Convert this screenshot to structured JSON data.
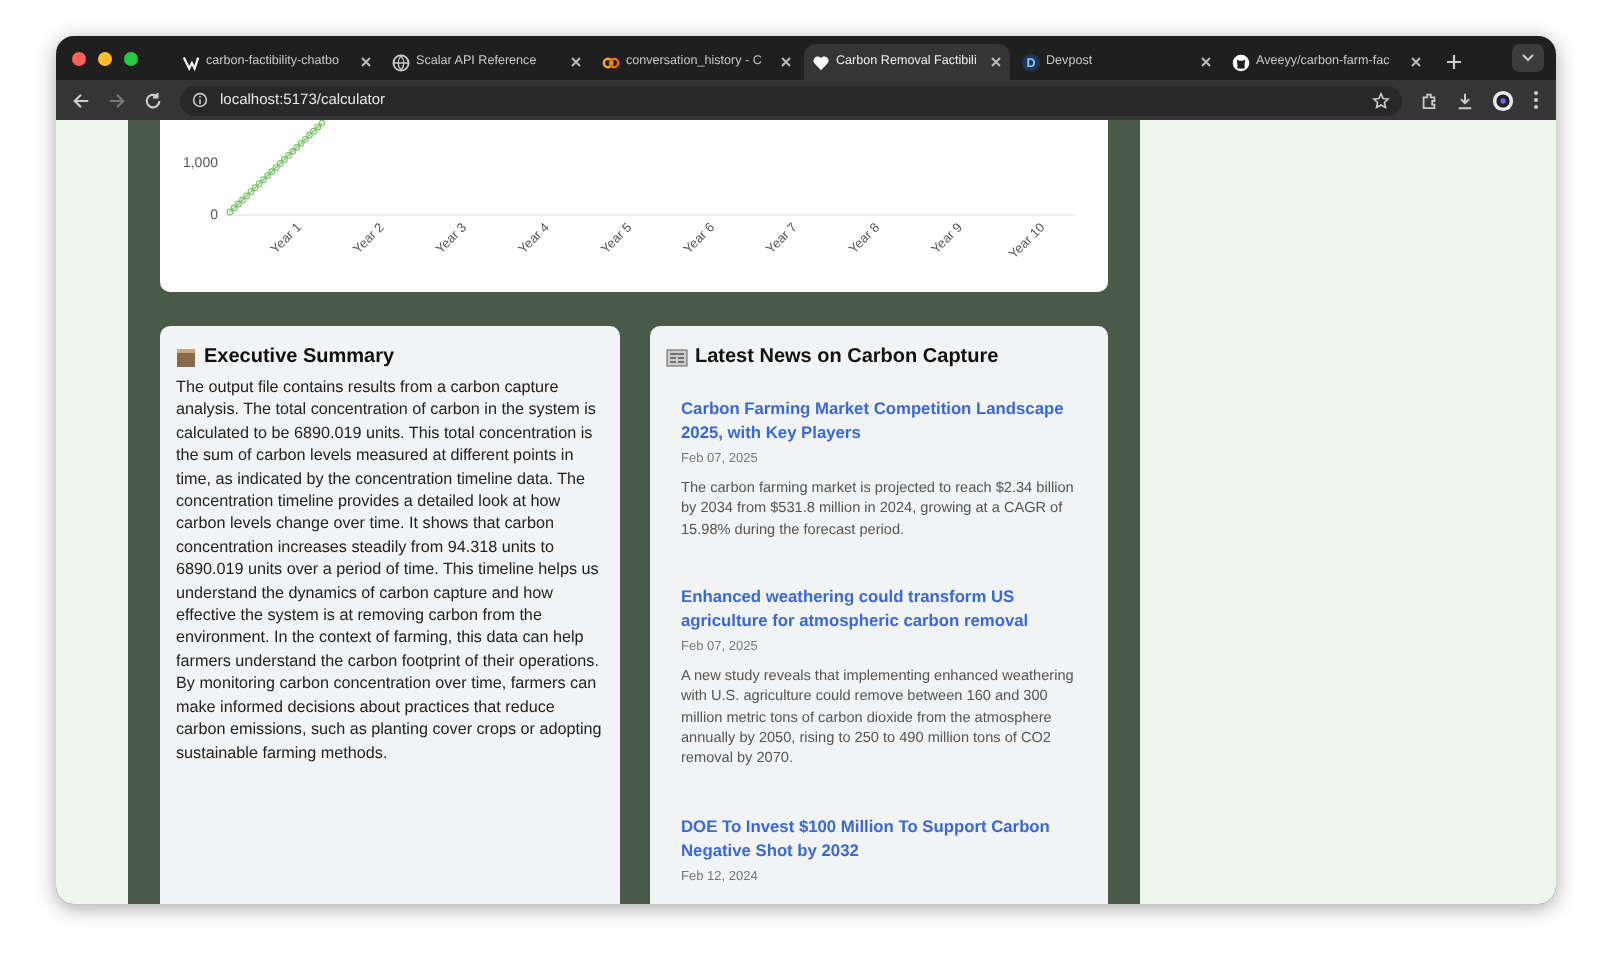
{
  "browser": {
    "tabs": [
      {
        "title": "carbon-factibility-chatbo",
        "kind": "logo",
        "selected": false
      },
      {
        "title": "Scalar API Reference",
        "kind": "globe",
        "selected": false
      },
      {
        "title": "conversation_history - C",
        "kind": "rings",
        "selected": false
      },
      {
        "title": "Carbon Removal Factibili",
        "kind": "heart",
        "selected": true
      },
      {
        "title": "Devpost",
        "kind": "letter",
        "letter": "D",
        "selected": false
      },
      {
        "title": "Aveeyy/carbon-farm-fac",
        "kind": "cat",
        "selected": false
      }
    ],
    "address": "localhost:5173/calculator"
  },
  "chart": {
    "y_tick_labels": [
      "1,000",
      "0"
    ],
    "x_labels": [
      "Year 1",
      "Year 2",
      "Year 3",
      "Year 4",
      "Year 5",
      "Year 6",
      "Year 7",
      "Year 8",
      "Year 9",
      "Year 10"
    ]
  },
  "summary": {
    "title": "Executive Summary",
    "text": "The output file contains results from a carbon capture analysis. The total concentration of carbon in the system is calculated to be 6890.019 units. This total concentration is the sum of carbon levels measured at different points in time, as indicated by the concentration timeline data. The concentration timeline provides a detailed look at how carbon levels change over time. It shows that carbon concentration increases steadily from 94.318 units to 6890.019 units over a period of time. This timeline helps us understand the dynamics of carbon capture and how effective the system is at removing carbon from the environment. In the context of farming, this data can help farmers understand the carbon footprint of their operations. By monitoring carbon concentration over time, farmers can make informed decisions about practices that reduce carbon emissions, such as planting cover crops or adopting sustainable farming methods."
  },
  "news": {
    "title": "Latest News on Carbon Capture",
    "items": [
      {
        "headline": "Carbon Farming Market Competition Landscape 2025, with Key Players",
        "date": "Feb 07, 2025",
        "summary": "The carbon farming market is projected to reach $2.34 billion by 2034 from $531.8 million in 2024, growing at a CAGR of 15.98% during the forecast period."
      },
      {
        "headline": "Enhanced weathering could transform US agriculture for atmospheric carbon removal",
        "date": "Feb 07, 2025",
        "summary": "A new study reveals that implementing enhanced weathering with U.S. agriculture could remove between 160 and 300 million metric tons of carbon dioxide from the atmosphere annually by 2050, rising to 250 to 490 million tons of CO2 removal by 2070."
      },
      {
        "headline": "DOE To Invest $100 Million To Support Carbon Negative Shot by 2032",
        "date": "Feb 12, 2024"
      }
    ]
  }
}
